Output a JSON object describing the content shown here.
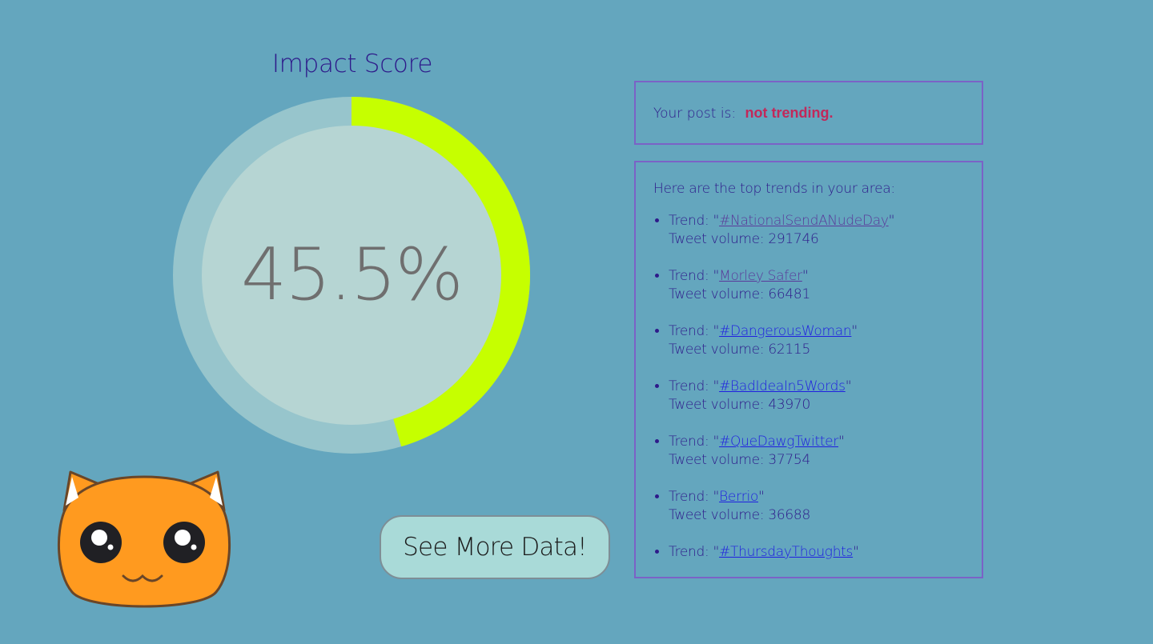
{
  "gauge": {
    "title": "Impact Score",
    "value_text": "45.5%",
    "value_fraction": 0.455,
    "colors": {
      "fill": "#c6ff00",
      "track": "#97c5cc",
      "inner": "#b6d5d3",
      "value_text": "#6f6f6f"
    }
  },
  "status": {
    "label": "Your post is:",
    "value": "not trending."
  },
  "trends": {
    "intro": "Here are the top trends in your area:",
    "trend_prefix": "Trend: \"",
    "trend_suffix": "\"",
    "volume_prefix": "Tweet volume: ",
    "items": [
      {
        "name": "#NationalSendANudeDay",
        "volume": "291746",
        "visited": true
      },
      {
        "name": "Morley Safer",
        "volume": "66481",
        "visited": true
      },
      {
        "name": "#DangerousWoman",
        "volume": "62115",
        "visited": false
      },
      {
        "name": "#BadIdeaIn5Words",
        "volume": "43970",
        "visited": false
      },
      {
        "name": "#QueDawgTwitter",
        "volume": "37754",
        "visited": false
      },
      {
        "name": "Berrio",
        "volume": "36688",
        "visited": false
      },
      {
        "name": "#ThursdayThoughts",
        "volume": null,
        "visited": false
      }
    ]
  },
  "actions": {
    "see_more_label": "See More Data!"
  },
  "mascot": {
    "icon": "cat-mascot-icon"
  },
  "colors": {
    "background": "#64a6be",
    "accent": "#2e1a8a",
    "box_border": "#7b62c6",
    "status_value": "#c2285a",
    "link": "#1f1fe0",
    "link_visited": "#5a3a9a"
  }
}
